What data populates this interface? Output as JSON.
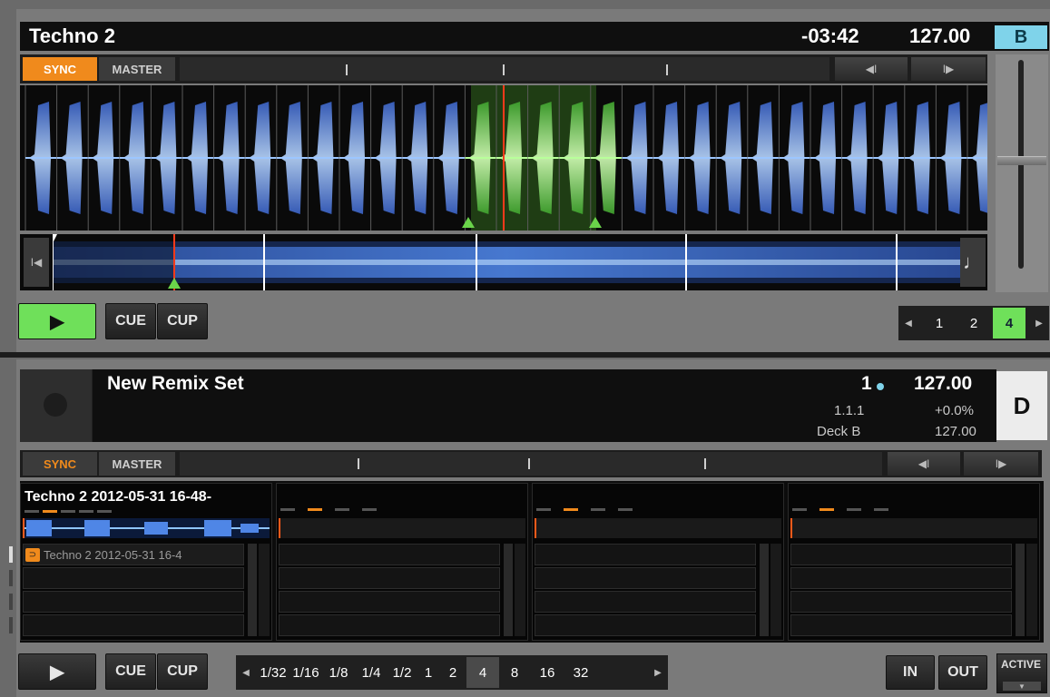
{
  "deck_b": {
    "title": "Techno 2",
    "time": "-03:42",
    "bpm": "127.00",
    "letter": "B",
    "sync_label": "SYNC",
    "master_label": "MASTER",
    "play_label": "▶",
    "cue_label": "CUE",
    "cup_label": "CUP",
    "loop_sizes": [
      "1",
      "2",
      "4"
    ],
    "loop_selected": "4"
  },
  "deck_d": {
    "title": "New Remix Set",
    "quant": "1",
    "position": "1.1.1",
    "source": "Deck B",
    "bpm": "127.00",
    "tempo_offset": "+0.0%",
    "bpm2": "127.00",
    "letter": "D",
    "sync_label": "SYNC",
    "master_label": "MASTER",
    "slot1_title": "Techno 2 2012-05-31 16-48-",
    "slot1_cell": "Techno 2 2012-05-31 16-4",
    "play_label": "▶",
    "cue_label": "CUE",
    "cup_label": "CUP",
    "loop_sizes": [
      "1/32",
      "1/16",
      "1/8",
      "1/4",
      "1/2",
      "1",
      "2",
      "4",
      "8",
      "16",
      "32"
    ],
    "loop_selected": "4",
    "in_label": "IN",
    "out_label": "OUT",
    "active_label": "ACTIVE"
  },
  "colors": {
    "accent_orange": "#f08a1c",
    "play_green": "#6fe05a",
    "deck_b_blue": "#7fd3ea",
    "waveform_blue": "#5f8fe6",
    "loop_green": "#6ad44a"
  }
}
